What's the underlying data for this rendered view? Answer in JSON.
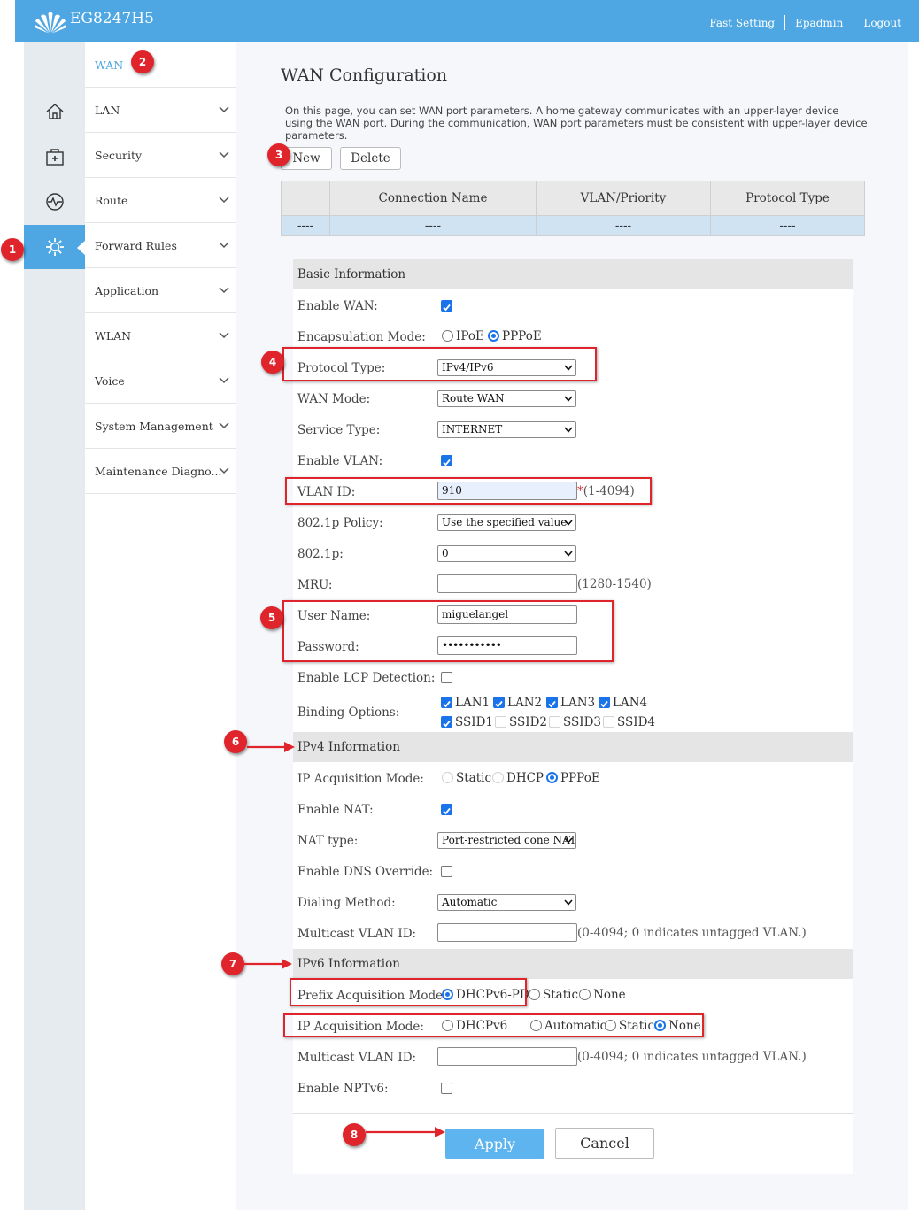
{
  "header": {
    "brand": "EG8247H5",
    "links": [
      "Fast Setting",
      "Epadmin",
      "Logout"
    ]
  },
  "rail": {
    "icons": [
      "home-icon",
      "toolbox-icon",
      "pulse-icon",
      "gear-icon"
    ],
    "active_icon": "gear-icon"
  },
  "sidebar": {
    "items": [
      {
        "label": "WAN"
      },
      {
        "label": "LAN"
      },
      {
        "label": "Security"
      },
      {
        "label": "Route"
      },
      {
        "label": "Forward Rules"
      },
      {
        "label": "Application"
      },
      {
        "label": "WLAN"
      },
      {
        "label": "Voice"
      },
      {
        "label": "System Management"
      },
      {
        "label": "Maintenance Diagno..."
      }
    ]
  },
  "page": {
    "title": "WAN Configuration",
    "description": "On this page, you can set WAN port parameters. A home gateway communicates with an upper-layer device using the WAN port. During the communication, WAN port parameters must be consistent with upper-layer device parameters.",
    "new_label": "New",
    "delete_label": "Delete"
  },
  "table": {
    "headers": [
      "",
      "Connection Name",
      "VLAN/Priority",
      "Protocol Type"
    ],
    "row": [
      "----",
      "----",
      "----",
      "----"
    ]
  },
  "basic": {
    "heading": "Basic Information",
    "enable_wan": {
      "label": "Enable WAN:",
      "checked": true
    },
    "encapsulation": {
      "label": "Encapsulation Mode:",
      "options": [
        "IPoE",
        "PPPoE"
      ],
      "selected": "PPPoE"
    },
    "protocol_type": {
      "label": "Protocol Type:",
      "value": "IPv4/IPv6"
    },
    "wan_mode": {
      "label": "WAN Mode:",
      "value": "Route WAN"
    },
    "service_type": {
      "label": "Service Type:",
      "value": "INTERNET"
    },
    "enable_vlan": {
      "label": "Enable VLAN:",
      "checked": true
    },
    "vlan_id": {
      "label": "VLAN ID:",
      "value": "910",
      "required": "*",
      "hint": "(1-4094)"
    },
    "policy_8021p": {
      "label": "802.1p Policy:",
      "value": "Use the specified value"
    },
    "value_8021p": {
      "label": "802.1p:",
      "value": "0"
    },
    "mru": {
      "label": "MRU:",
      "value": "",
      "hint": "(1280-1540)"
    },
    "user_name": {
      "label": "User Name:",
      "value": "miguelangel"
    },
    "password": {
      "label": "Password:",
      "value": "•••••••••••"
    },
    "enable_lcp": {
      "label": "Enable LCP Detection:",
      "checked": false
    },
    "binding": {
      "label": "Binding Options:",
      "row1": [
        {
          "name": "LAN1",
          "checked": true
        },
        {
          "name": "LAN2",
          "checked": true
        },
        {
          "name": "LAN3",
          "checked": true
        },
        {
          "name": "LAN4",
          "checked": true
        }
      ],
      "row2": [
        {
          "name": "SSID1",
          "checked": true
        },
        {
          "name": "SSID2",
          "checked": false
        },
        {
          "name": "SSID3",
          "checked": false
        },
        {
          "name": "SSID4",
          "checked": false
        }
      ]
    }
  },
  "ipv4": {
    "heading": "IPv4 Information",
    "ip_mode": {
      "label": "IP Acquisition Mode:",
      "options": [
        "Static",
        "DHCP",
        "PPPoE"
      ],
      "selected": "PPPoE"
    },
    "enable_nat": {
      "label": "Enable NAT:",
      "checked": true
    },
    "nat_type": {
      "label": "NAT type:",
      "value": "Port-restricted cone NAT"
    },
    "dns_override": {
      "label": "Enable DNS Override:",
      "checked": false
    },
    "dialing": {
      "label": "Dialing Method:",
      "value": "Automatic"
    },
    "multicast_vlan": {
      "label": "Multicast VLAN ID:",
      "value": "",
      "hint": "(0-4094; 0 indicates untagged VLAN.)"
    }
  },
  "ipv6": {
    "heading": "IPv6 Information",
    "prefix_mode": {
      "label": "Prefix Acquisition Mode:",
      "options": [
        "DHCPv6-PD",
        "Static",
        "None"
      ],
      "selected": "DHCPv6-PD"
    },
    "ip_mode": {
      "label": "IP Acquisition Mode:",
      "options": [
        "DHCPv6",
        "Automatic",
        "Static",
        "None"
      ],
      "selected": "None"
    },
    "multicast_vlan": {
      "label": "Multicast VLAN ID:",
      "value": "",
      "hint": "(0-4094; 0 indicates untagged VLAN.)"
    },
    "enable_nptv6": {
      "label": "Enable NPTv6:",
      "checked": false
    }
  },
  "actions": {
    "apply": "Apply",
    "cancel": "Cancel"
  },
  "annotations": {
    "badges": [
      "1",
      "2",
      "3",
      "4",
      "5",
      "6",
      "7",
      "8"
    ],
    "color": "#e0242b"
  },
  "colors": {
    "accent": "#4ea7e2",
    "checkbox": "#1a73e8",
    "table_row": "#cfe3f3"
  }
}
